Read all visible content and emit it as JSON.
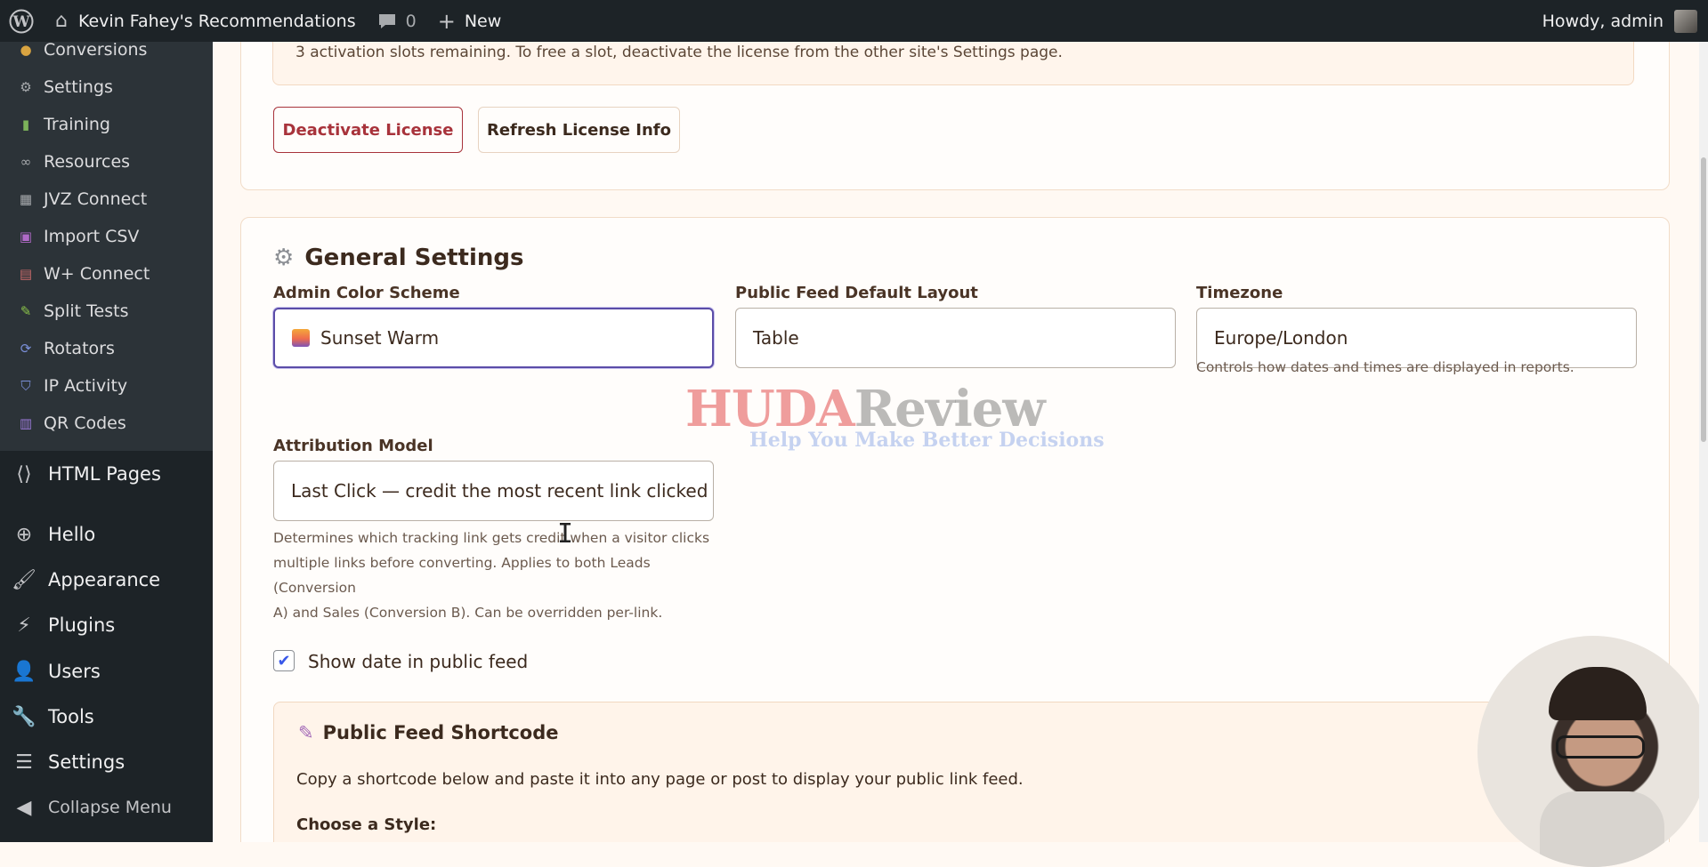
{
  "adminbar": {
    "site_name": "Kevin Fahey's Recommendations",
    "comments_count": "0",
    "new_label": "New",
    "howdy": "Howdy, admin"
  },
  "plugin_menu": [
    {
      "label": "Conversions",
      "icon": "coin-icon"
    },
    {
      "label": "Settings",
      "icon": "gear-icon"
    },
    {
      "label": "Training",
      "icon": "books-icon"
    },
    {
      "label": "Resources",
      "icon": "link-icon"
    },
    {
      "label": "JVZ Connect",
      "icon": "plug-icon"
    },
    {
      "label": "Import CSV",
      "icon": "import-icon"
    },
    {
      "label": "W+ Connect",
      "icon": "plug-icon"
    },
    {
      "label": "Split Tests",
      "icon": "pencil-icon"
    },
    {
      "label": "Rotators",
      "icon": "rotate-icon"
    },
    {
      "label": "IP Activity",
      "icon": "shield-icon"
    },
    {
      "label": "QR Codes",
      "icon": "qr-icon"
    }
  ],
  "wp_menu": [
    {
      "label": "HTML Pages",
      "icon": "code-page-icon"
    },
    {
      "label": "Hello",
      "icon": "plus-circle-icon"
    },
    {
      "label": "Appearance",
      "icon": "brush-icon"
    },
    {
      "label": "Plugins",
      "icon": "plugin-icon"
    },
    {
      "label": "Users",
      "icon": "user-icon"
    },
    {
      "label": "Tools",
      "icon": "wrench-icon"
    },
    {
      "label": "Settings",
      "icon": "sliders-icon"
    }
  ],
  "collapse_label": "Collapse Menu",
  "license": {
    "notice": "3 activation slots remaining. To free a slot, deactivate the license from the other site's Settings page.",
    "deactivate_label": "Deactivate License",
    "refresh_label": "Refresh License Info"
  },
  "general": {
    "title": "General Settings",
    "color_scheme_label": "Admin Color Scheme",
    "color_scheme_value": "Sunset Warm",
    "layout_label": "Public Feed Default Layout",
    "layout_value": "Table",
    "timezone_label": "Timezone",
    "timezone_value": "Europe/London",
    "timezone_help": "Controls how dates and times are displayed in reports.",
    "attribution_label": "Attribution Model",
    "attribution_value": "Last Click — credit the most recent link clicked",
    "attribution_help_1": "Determines which tracking link gets credit when a visitor clicks",
    "attribution_help_2": "multiple links before converting. Applies to both Leads (Conversion",
    "attribution_help_3": "A) and Sales (Conversion B). Can be overridden per-link.",
    "show_date_label": "Show date in public feed",
    "show_date_checked": true
  },
  "shortcode": {
    "title": "Public Feed Shortcode",
    "description": "Copy a shortcode below and paste it into any page or post to display your public link feed.",
    "choose_style": "Choose a Style:"
  },
  "watermark": {
    "brand_red": "HUDA",
    "brand_gray": "Review",
    "tagline": "Help You Make Better Decisions"
  }
}
